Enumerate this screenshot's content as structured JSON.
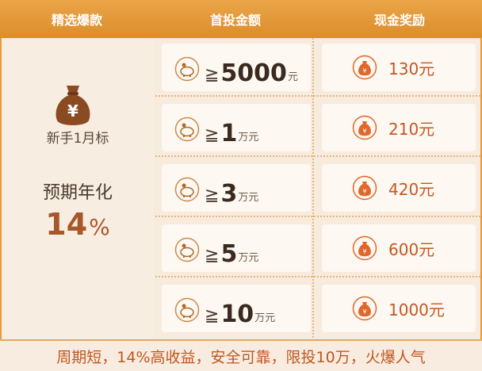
{
  "header": {
    "col1": "精选爆款",
    "col2": "首投金额",
    "col3": "现金奖励"
  },
  "product": {
    "bag_icon": "money-bag-yen-icon",
    "name": "新手1月标",
    "annual_label": "预期年化",
    "rate_value": "14",
    "rate_unit": "%"
  },
  "tiers": [
    {
      "ge": "≧",
      "amount": "5000",
      "unit": "元",
      "reward": "130元"
    },
    {
      "ge": "≧",
      "amount": "1",
      "unit": "万元",
      "reward": "210元"
    },
    {
      "ge": "≧",
      "amount": "3",
      "unit": "万元",
      "reward": "420元"
    },
    {
      "ge": "≧",
      "amount": "5",
      "unit": "万元",
      "reward": "600元"
    },
    {
      "ge": "≧",
      "amount": "10",
      "unit": "万元",
      "reward": "1000元"
    }
  ],
  "footer": {
    "text": "周期短，14%高收益，安全可靠，限投10万，火爆人气"
  },
  "colors": {
    "header_orange": "#dd8d2a",
    "reward_text": "#c4571f",
    "icon_orange": "#e0672a",
    "bag_brown": "#8a4a22"
  }
}
